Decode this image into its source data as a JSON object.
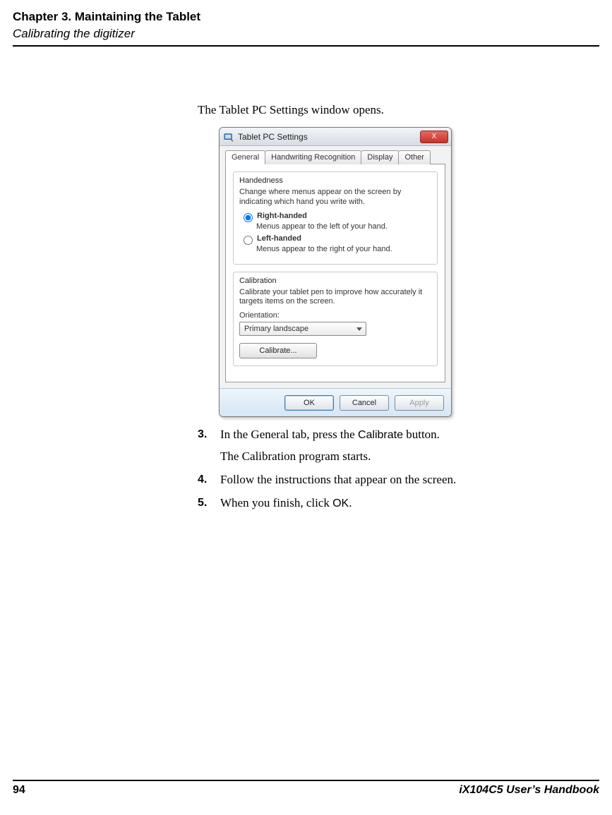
{
  "header": {
    "chapter": "Chapter 3. Maintaining the Tablet",
    "section": "Calibrating the digitizer"
  },
  "intro": "The Tablet PC Settings window opens.",
  "dialog": {
    "title": "Tablet PC Settings",
    "close": "X",
    "tabs": {
      "general": "General",
      "handwriting": "Handwriting Recognition",
      "display": "Display",
      "other": "Other"
    },
    "handedness": {
      "title": "Handedness",
      "desc": "Change where menus appear on the screen by indicating which hand you write with.",
      "right_label": "Right-handed",
      "right_sub": "Menus appear to the left of your hand.",
      "left_label": "Left-handed",
      "left_sub": "Menus appear to the right of your hand."
    },
    "calibration": {
      "title": "Calibration",
      "desc": "Calibrate your tablet pen to improve how accurately it targets items on the screen.",
      "orientation_label": "Orientation:",
      "orientation_value": "Primary landscape",
      "calibrate_btn": "Calibrate..."
    },
    "buttons": {
      "ok": "OK",
      "cancel": "Cancel",
      "apply": "Apply"
    }
  },
  "steps": {
    "s3_num": "3.",
    "s3_a": "In the General tab, press the ",
    "s3_b": "Calibrate",
    "s3_c": " button.",
    "s3_sub": "The Calibration program starts.",
    "s4_num": "4.",
    "s4": "Follow the instructions that appear on the screen.",
    "s5_num": "5.",
    "s5_a": "When you finish, click ",
    "s5_b": "OK",
    "s5_c": "."
  },
  "footer": {
    "page": "94",
    "book": "iX104C5 User’s Handbook"
  }
}
